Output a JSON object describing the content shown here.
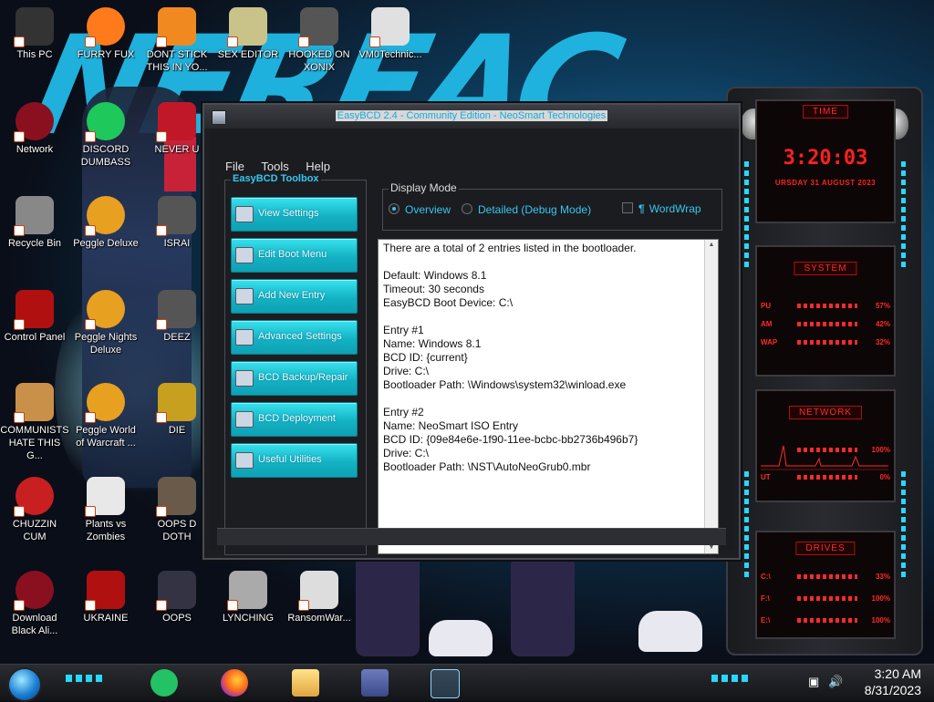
{
  "desktop": {
    "icons": [
      {
        "label": "This PC"
      },
      {
        "label": "FURRY FUX"
      },
      {
        "label": "DONT STICK THIS IN YO..."
      },
      {
        "label": "SEX EDITOR"
      },
      {
        "label": "HOOKED ON XONIX"
      },
      {
        "label": "VM0Technic..."
      },
      {
        "label": "Network"
      },
      {
        "label": "DISCORD DUMBASS"
      },
      {
        "label": "NEVER U"
      },
      {
        "label": "Recycle Bin"
      },
      {
        "label": "Peggle Deluxe"
      },
      {
        "label": "ISRAI"
      },
      {
        "label": "Control Panel"
      },
      {
        "label": "Peggle Nights Deluxe"
      },
      {
        "label": "DEEZ"
      },
      {
        "label": "COMMUNISTS HATE THIS G..."
      },
      {
        "label": "Peggle World of Warcraft ..."
      },
      {
        "label": "DIE"
      },
      {
        "label": "CHUZZIN CUM"
      },
      {
        "label": "Plants vs Zombies"
      },
      {
        "label": "OOPS D DOTH"
      },
      {
        "label": "Download Black Ali..."
      },
      {
        "label": "UKRAINE"
      },
      {
        "label": "OOPS"
      },
      {
        "label": "LYNCHING"
      },
      {
        "label": "RansomWar..."
      }
    ]
  },
  "gadget": {
    "time_title": "TIME",
    "clock": "3:20:03",
    "date": "URSDAY 31 AUGUST 2023",
    "system_title": "SYSTEM",
    "system_rows": [
      {
        "label": "PU",
        "pct": "57%"
      },
      {
        "label": "AM",
        "pct": "42%"
      },
      {
        "label": "WAP",
        "pct": "32%"
      }
    ],
    "network_title": "NETWORK",
    "network_rows": [
      {
        "label": "",
        "pct": "100%"
      },
      {
        "label": "UT",
        "pct": "0%"
      }
    ],
    "drives_title": "DRIVES",
    "drive_rows": [
      {
        "label": "C:\\",
        "pct": "33%"
      },
      {
        "label": "F:\\",
        "pct": "100%"
      },
      {
        "label": "E:\\",
        "pct": "100%"
      }
    ]
  },
  "window": {
    "title": "EasyBCD 2.4 - Community Edition - NeoSmart Technologies",
    "menu": [
      "File",
      "Tools",
      "Help"
    ],
    "toolbox": {
      "title": "EasyBCD Toolbox",
      "buttons": [
        {
          "label": "View Settings"
        },
        {
          "label": "Edit Boot Menu"
        },
        {
          "label": "Add New Entry"
        },
        {
          "label": "Advanced Settings"
        },
        {
          "label": "BCD Backup/Repair"
        },
        {
          "label": "BCD Deployment"
        },
        {
          "label": "Useful Utilities"
        }
      ]
    },
    "display_mode": {
      "title": "Display Mode",
      "overview": "Overview",
      "detailed": "Detailed (Debug Mode)",
      "selected": "overview",
      "wordwrap": "WordWrap",
      "wordwrap_checked": false
    },
    "output": "There are a total of 2 entries listed in the bootloader.\n\nDefault: Windows 8.1\nTimeout: 30 seconds\nEasyBCD Boot Device: C:\\\n\nEntry #1\nName: Windows 8.1\nBCD ID: {current}\nDrive: C:\\\nBootloader Path: \\Windows\\system32\\winload.exe\n\nEntry #2\nName: NeoSmart ISO Entry\nBCD ID: {09e84e6e-1f90-11ee-bcbc-bb2736b496b7}\nDrive: C:\\\nBootloader Path: \\NST\\AutoNeoGrub0.mbr"
  },
  "taskbar": {
    "time": "3:20 AM",
    "date": "8/31/2023"
  },
  "colors": {
    "accent": "#29d7ff",
    "gadget_red": "#ff2020",
    "button_cyan": "#14b2c4"
  }
}
